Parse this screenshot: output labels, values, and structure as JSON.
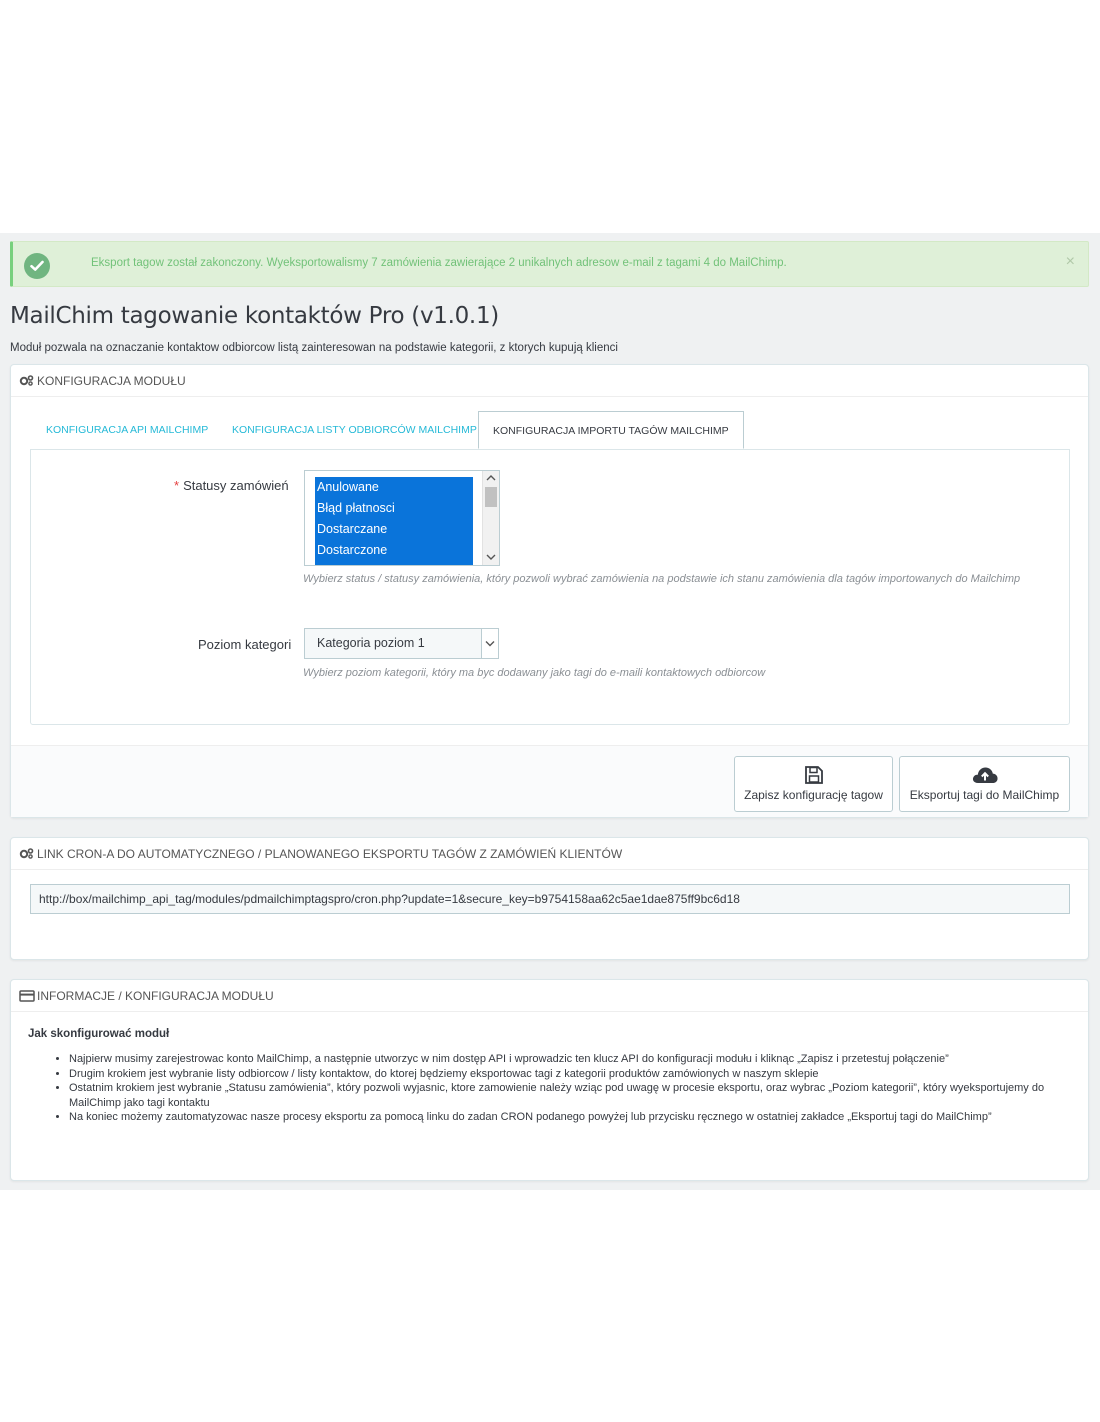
{
  "alert": {
    "message": "Eksport tagow został zakonczony. Wyeksportowalismy 7 zamówienia zawierające 2 unikalnych adresow e-mail z tagami 4 do MailChimp.",
    "close": "×"
  },
  "page": {
    "title": "MailChim tagowanie kontaktów Pro (v1.0.1)",
    "description": "Moduł pozwala na oznaczanie kontaktow odbiorcow listą zainteresowan na podstawie kategorii, z ktorych kupują klienci"
  },
  "config_panel": {
    "heading": "KONFIGURACJA MODUŁU",
    "tabs": [
      {
        "label": "KONFIGURACJA API MAILCHIMP",
        "active": false
      },
      {
        "label": "KONFIGURACJA LISTY ODBIORCÓW MAILCHIMP",
        "active": false
      },
      {
        "label": "KONFIGURACJA IMPORTU TAGÓW MAILCHIMP",
        "active": true
      }
    ],
    "statuses": {
      "label": "Statusy zamówień",
      "required_mark": "*",
      "options": [
        "Anulowane",
        "Błąd płatnosci",
        "Dostarczane",
        "Dostarczone"
      ],
      "help": "Wybierz status / statusy zamówienia, który pozwoli wybrać zamówienia na podstawie ich stanu zamówienia dla tagów importowanych do Mailchimp"
    },
    "category_level": {
      "label": "Poziom kategori",
      "value": "Kategoria poziom 1",
      "help": "Wybierz poziom kategorii, który ma byc dodawany jako tagi do e-maili kontaktowych odbiorcow"
    },
    "buttons": {
      "save": "Zapisz konfigurację tagow",
      "export": "Eksportuj tagi do MailChimp"
    }
  },
  "cron_panel": {
    "heading": "LINK CRON-A DO AUTOMATYCZNEGO / PLANOWANEGO EKSPORTU TAGÓW Z ZAMÓWIEŃ KLIENTÓW",
    "url": "http://box/mailchimp_api_tag/modules/pdmailchimptagspro/cron.php?update=1&secure_key=b9754158aa62c5ae1dae875ff9bc6d18"
  },
  "info_panel": {
    "heading": "INFORMACJE / KONFIGURACJA MODUŁU",
    "title": "Jak skonfigurować moduł",
    "items": [
      "Najpierw musimy zarejestrowac konto MailChimp, a następnie utworzyc w nim dostęp API i wprowadzic ten klucz API do konfiguracji modułu i kliknąc „Zapisz i przetestuj połączenie”",
      "Drugim krokiem jest wybranie listy odbiorcow / listy kontaktow, do ktorej będziemy eksportowac tagi z kategorii produktów zamówionych w naszym sklepie",
      "Ostatnim krokiem jest wybranie „Statusu zamówienia”, który pozwoli wyjasnic, ktore zamowienie należy wziąc pod uwagę w procesie eksportu, oraz wybrac „Poziom kategorii”, który wyeksportujemy do MailChimp jako tagi kontaktu",
      "Na koniec możemy zautomatyzowac nasze procesy eksportu za pomocą linku do zadan CRON podanego powyżej lub przycisku ręcznego w ostatniej zakładce „Eksportuj tagi do MailChimp”"
    ]
  },
  "colors": {
    "accent": "#25b9d7",
    "success_bg": "#dff0d8",
    "success_text": "#72c279",
    "selected_option": "#0a74da",
    "background": "#eff1f2"
  }
}
